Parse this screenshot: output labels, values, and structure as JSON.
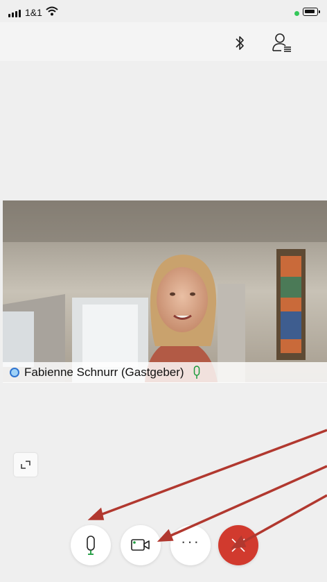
{
  "status_bar": {
    "carrier": "1&1",
    "signal_icon": "signal-bars-icon",
    "wifi_icon": "wifi-icon",
    "battery_icon": "battery-icon"
  },
  "top_bar": {
    "bluetooth_icon": "bluetooth-icon",
    "participants_icon": "participants-list-icon"
  },
  "video": {
    "participant_name": "Fabienne Schnurr (Gastgeber)",
    "mic_icon": "microphone-icon"
  },
  "controls": {
    "expand_icon": "expand-icon",
    "mute_icon": "microphone-icon",
    "camera_icon": "video-camera-icon",
    "more_label": "···",
    "end_icon": "close-icon"
  },
  "colors": {
    "accent_green": "#1a9a3b",
    "end_call_red": "#d13a2e",
    "annotation_arrow": "#b1382f",
    "status_blue": "#2f74d0"
  }
}
